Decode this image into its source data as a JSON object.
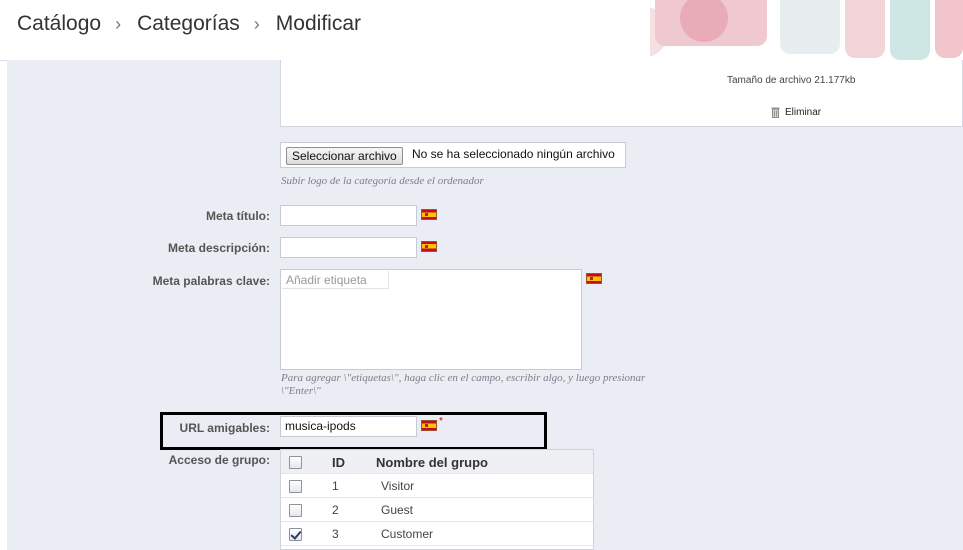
{
  "breadcrumb": [
    "Catálogo",
    "Categorías",
    "Modificar"
  ],
  "image": {
    "file_size": "Tamaño de archivo 21.177kb",
    "delete_label": "Eliminar"
  },
  "logo_upload": {
    "button_label": "Seleccionar archivo",
    "status_text": "No se ha seleccionado ningún archivo",
    "hint": "Subir logo de la categoría desde el ordenador"
  },
  "meta_title": {
    "label": "Meta título:",
    "value": ""
  },
  "meta_description": {
    "label": "Meta descripción:",
    "value": ""
  },
  "meta_keywords": {
    "label": "Meta palabras clave:",
    "placeholder": "Añadir etiqueta",
    "hint_line1": "Para agregar \\\"etiquetas\\\", haga clic en el campo, escribir algo, y luego presionar",
    "hint_line2": "\\\"Enter\\\""
  },
  "friendly_url": {
    "label": "URL amigables:",
    "value": "musica-ipods",
    "required_mark": "*"
  },
  "group_access": {
    "label": "Acceso de grupo:",
    "columns": [
      "ID",
      "Nombre del grupo"
    ],
    "rows": [
      {
        "id": "1",
        "name": "Visitor",
        "checked": false
      },
      {
        "id": "2",
        "name": "Guest",
        "checked": false
      },
      {
        "id": "3",
        "name": "Customer",
        "checked": true
      }
    ]
  },
  "colors": {
    "main_background": "#ebedf4",
    "highlight_border": "#000000",
    "flag_red": "#c60b1e",
    "flag_yellow": "#ffc400"
  },
  "icons": [
    "chevron-right-icon",
    "trash-icon",
    "spain-flag-icon",
    "checkbox-icon"
  ]
}
